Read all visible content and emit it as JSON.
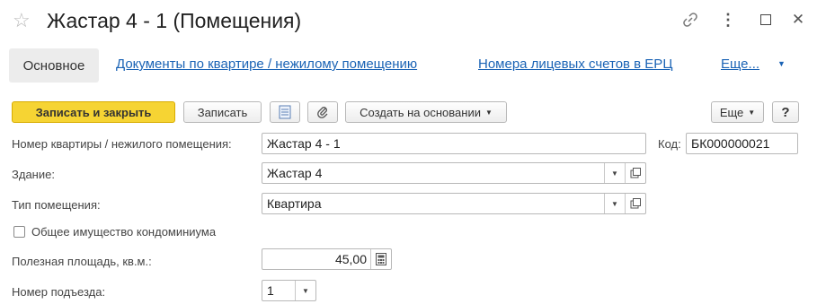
{
  "window": {
    "title": "Жастар 4 - 1 (Помещения)",
    "star_icon": "☆",
    "link_icon": "link-icon",
    "more_icon": "⋮",
    "maximize_icon": "□",
    "close_icon": "✕"
  },
  "tabs": {
    "active": "Основное",
    "links": [
      "Документы по квартире / нежилому помещению",
      "Номера лицевых счетов в ЕРЦ",
      "Еще..."
    ]
  },
  "toolbar": {
    "save_close": "Записать и закрыть",
    "save": "Записать",
    "create_based": "Создать на основании",
    "more": "Еще",
    "help": "?"
  },
  "form": {
    "number_label": "Номер квартиры / нежилого помещения:",
    "number_value": "Жастар 4 - 1",
    "code_label": "Код:",
    "code_value": "БК000000021",
    "building_label": "Здание:",
    "building_value": "Жастар 4",
    "type_label": "Тип помещения:",
    "type_value": "Квартира",
    "common_property_label": "Общее имущество кондоминиума",
    "common_property_checked": false,
    "area_label": "Полезная площадь, кв.м.:",
    "area_value": "45,00",
    "entrance_label": "Номер подъезда:",
    "entrance_value": "1"
  },
  "colors": {
    "accent_yellow": "#f6d433",
    "link_blue": "#1a63b5"
  }
}
